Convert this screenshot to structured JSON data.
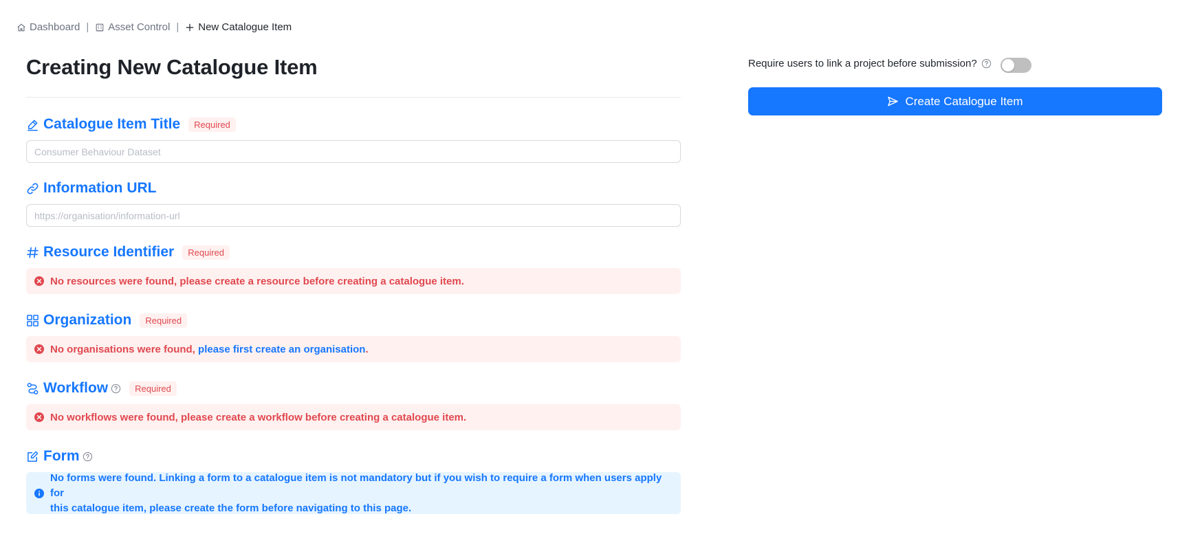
{
  "breadcrumb": {
    "items": [
      {
        "label": "Dashboard",
        "icon": "home-icon"
      },
      {
        "label": "Asset Control",
        "icon": "building-icon"
      },
      {
        "label": "New Catalogue Item",
        "icon": "plus-icon"
      }
    ],
    "separator": "|"
  },
  "page": {
    "title": "Creating New Catalogue Item"
  },
  "required_label": "Required",
  "sections": {
    "title": {
      "label": "Catalogue Item Title",
      "icon": "signature-icon",
      "placeholder": "Consumer Behaviour Dataset",
      "value": ""
    },
    "url": {
      "label": "Information URL",
      "icon": "link-icon",
      "placeholder": "https://organisation/information-url",
      "value": ""
    },
    "resource": {
      "label": "Resource Identifier",
      "icon": "hash-icon",
      "message": "No resources were found, please create a resource before creating a catalogue item."
    },
    "organization": {
      "label": "Organization",
      "icon": "grid-icon",
      "message_prefix": "No organisations were found, ",
      "link_text": "please first create an organisation",
      "message_suffix": "."
    },
    "workflow": {
      "label": "Workflow",
      "icon": "workflow-icon",
      "message": "No workflows were found, please create a workflow before creating a catalogue item."
    },
    "form": {
      "label": "Form",
      "icon": "edit-icon",
      "message_line1": "No forms were found. Linking a form to a catalogue item is not mandatory but if you wish to require a form when users apply for",
      "message_line2": "this catalogue item, please create the form before navigating to this page."
    }
  },
  "settings": {
    "require_project_label": "Require users to link a project before submission?",
    "require_project_enabled": false
  },
  "actions": {
    "create_label": "Create Catalogue Item",
    "create_icon": "send-icon"
  },
  "colors": {
    "accent": "#1677ff",
    "error": "#e0484f",
    "error_bg": "#fff1f0",
    "info_bg": "#e6f4ff",
    "toggle_off": "#bfbfbf"
  }
}
